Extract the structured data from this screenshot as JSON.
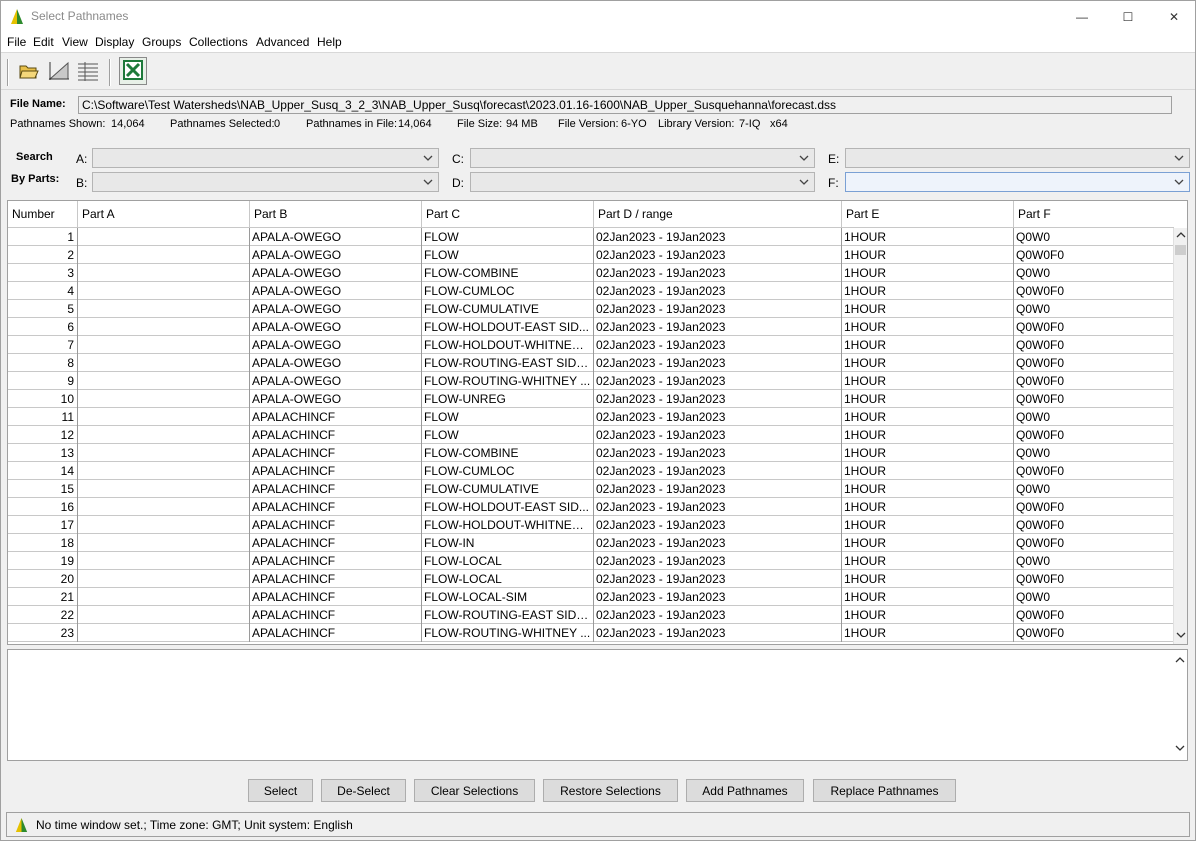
{
  "window": {
    "title": "Select Pathnames",
    "minimize": "—",
    "maximize": "☐",
    "close": "✕"
  },
  "menu": [
    "File",
    "Edit",
    "View",
    "Display",
    "Groups",
    "Collections",
    "Advanced",
    "Help"
  ],
  "file": {
    "name_label": "File Name:",
    "path": "C:\\Software\\Test Watersheds\\NAB_Upper_Susq_3_2_3\\NAB_Upper_Susq\\forecast\\2023.01.16-1600\\NAB_Upper_Susquehanna\\forecast.dss",
    "shown_label": "Pathnames Shown:",
    "shown": "14,064",
    "selected_label": "Pathnames Selected:",
    "selected": "0",
    "infile_label": "Pathnames in File:",
    "infile": "14,064",
    "size_label": "File Size:",
    "size": "94  MB",
    "version_label": "File Version:",
    "version": "6-YO",
    "lib_label": "Library Version:",
    "lib": "7-IQ",
    "arch": "x64"
  },
  "search": {
    "label1": "Search",
    "label2": "By Parts:",
    "a": "A:",
    "b": "B:",
    "c": "C:",
    "d": "D:",
    "e": "E:",
    "f": "F:"
  },
  "table": {
    "headers": [
      "Number",
      "Part A",
      "Part B",
      "Part C",
      "Part D / range",
      "Part E",
      "Part F"
    ],
    "rows": [
      [
        "1",
        "",
        "APALA-OWEGO",
        "FLOW",
        "02Jan2023 - 19Jan2023",
        "1HOUR",
        "Q0W0"
      ],
      [
        "2",
        "",
        "APALA-OWEGO",
        "FLOW",
        "02Jan2023 - 19Jan2023",
        "1HOUR",
        "Q0W0F0"
      ],
      [
        "3",
        "",
        "APALA-OWEGO",
        "FLOW-COMBINE",
        "02Jan2023 - 19Jan2023",
        "1HOUR",
        "Q0W0"
      ],
      [
        "4",
        "",
        "APALA-OWEGO",
        "FLOW-CUMLOC",
        "02Jan2023 - 19Jan2023",
        "1HOUR",
        "Q0W0F0"
      ],
      [
        "5",
        "",
        "APALA-OWEGO",
        "FLOW-CUMULATIVE",
        "02Jan2023 - 19Jan2023",
        "1HOUR",
        "Q0W0"
      ],
      [
        "6",
        "",
        "APALA-OWEGO",
        "FLOW-HOLDOUT-EAST SID...",
        "02Jan2023 - 19Jan2023",
        "1HOUR",
        "Q0W0F0"
      ],
      [
        "7",
        "",
        "APALA-OWEGO",
        "FLOW-HOLDOUT-WHITNEY ...",
        "02Jan2023 - 19Jan2023",
        "1HOUR",
        "Q0W0F0"
      ],
      [
        "8",
        "",
        "APALA-OWEGO",
        "FLOW-ROUTING-EAST SIDN...",
        "02Jan2023 - 19Jan2023",
        "1HOUR",
        "Q0W0F0"
      ],
      [
        "9",
        "",
        "APALA-OWEGO",
        "FLOW-ROUTING-WHITNEY ...",
        "02Jan2023 - 19Jan2023",
        "1HOUR",
        "Q0W0F0"
      ],
      [
        "10",
        "",
        "APALA-OWEGO",
        "FLOW-UNREG",
        "02Jan2023 - 19Jan2023",
        "1HOUR",
        "Q0W0F0"
      ],
      [
        "11",
        "",
        "APALACHINCF",
        "FLOW",
        "02Jan2023 - 19Jan2023",
        "1HOUR",
        "Q0W0"
      ],
      [
        "12",
        "",
        "APALACHINCF",
        "FLOW",
        "02Jan2023 - 19Jan2023",
        "1HOUR",
        "Q0W0F0"
      ],
      [
        "13",
        "",
        "APALACHINCF",
        "FLOW-COMBINE",
        "02Jan2023 - 19Jan2023",
        "1HOUR",
        "Q0W0"
      ],
      [
        "14",
        "",
        "APALACHINCF",
        "FLOW-CUMLOC",
        "02Jan2023 - 19Jan2023",
        "1HOUR",
        "Q0W0F0"
      ],
      [
        "15",
        "",
        "APALACHINCF",
        "FLOW-CUMULATIVE",
        "02Jan2023 - 19Jan2023",
        "1HOUR",
        "Q0W0"
      ],
      [
        "16",
        "",
        "APALACHINCF",
        "FLOW-HOLDOUT-EAST SID...",
        "02Jan2023 - 19Jan2023",
        "1HOUR",
        "Q0W0F0"
      ],
      [
        "17",
        "",
        "APALACHINCF",
        "FLOW-HOLDOUT-WHITNEY ...",
        "02Jan2023 - 19Jan2023",
        "1HOUR",
        "Q0W0F0"
      ],
      [
        "18",
        "",
        "APALACHINCF",
        "FLOW-IN",
        "02Jan2023 - 19Jan2023",
        "1HOUR",
        "Q0W0F0"
      ],
      [
        "19",
        "",
        "APALACHINCF",
        "FLOW-LOCAL",
        "02Jan2023 - 19Jan2023",
        "1HOUR",
        "Q0W0"
      ],
      [
        "20",
        "",
        "APALACHINCF",
        "FLOW-LOCAL",
        "02Jan2023 - 19Jan2023",
        "1HOUR",
        "Q0W0F0"
      ],
      [
        "21",
        "",
        "APALACHINCF",
        "FLOW-LOCAL-SIM",
        "02Jan2023 - 19Jan2023",
        "1HOUR",
        "Q0W0"
      ],
      [
        "22",
        "",
        "APALACHINCF",
        "FLOW-ROUTING-EAST SIDN...",
        "02Jan2023 - 19Jan2023",
        "1HOUR",
        "Q0W0F0"
      ],
      [
        "23",
        "",
        "APALACHINCF",
        "FLOW-ROUTING-WHITNEY ...",
        "02Jan2023 - 19Jan2023",
        "1HOUR",
        "Q0W0F0"
      ]
    ]
  },
  "buttons": {
    "select": "Select",
    "deselect": "De-Select",
    "clear": "Clear Selections",
    "restore": "Restore Selections",
    "add": "Add Pathnames",
    "replace": "Replace Pathnames"
  },
  "status": "No time window set.;  Time zone: GMT;  Unit system: English",
  "colors": {
    "accent_green": "#2e8b2e",
    "accent_yellow": "#e5c100",
    "excel_green": "#1d7a3a"
  },
  "icons": {
    "app": "hec-dssvue-icon",
    "open": "open-folder-icon",
    "plot": "plot-icon",
    "tabulate": "tabulate-icon",
    "excel": "excel-icon"
  }
}
